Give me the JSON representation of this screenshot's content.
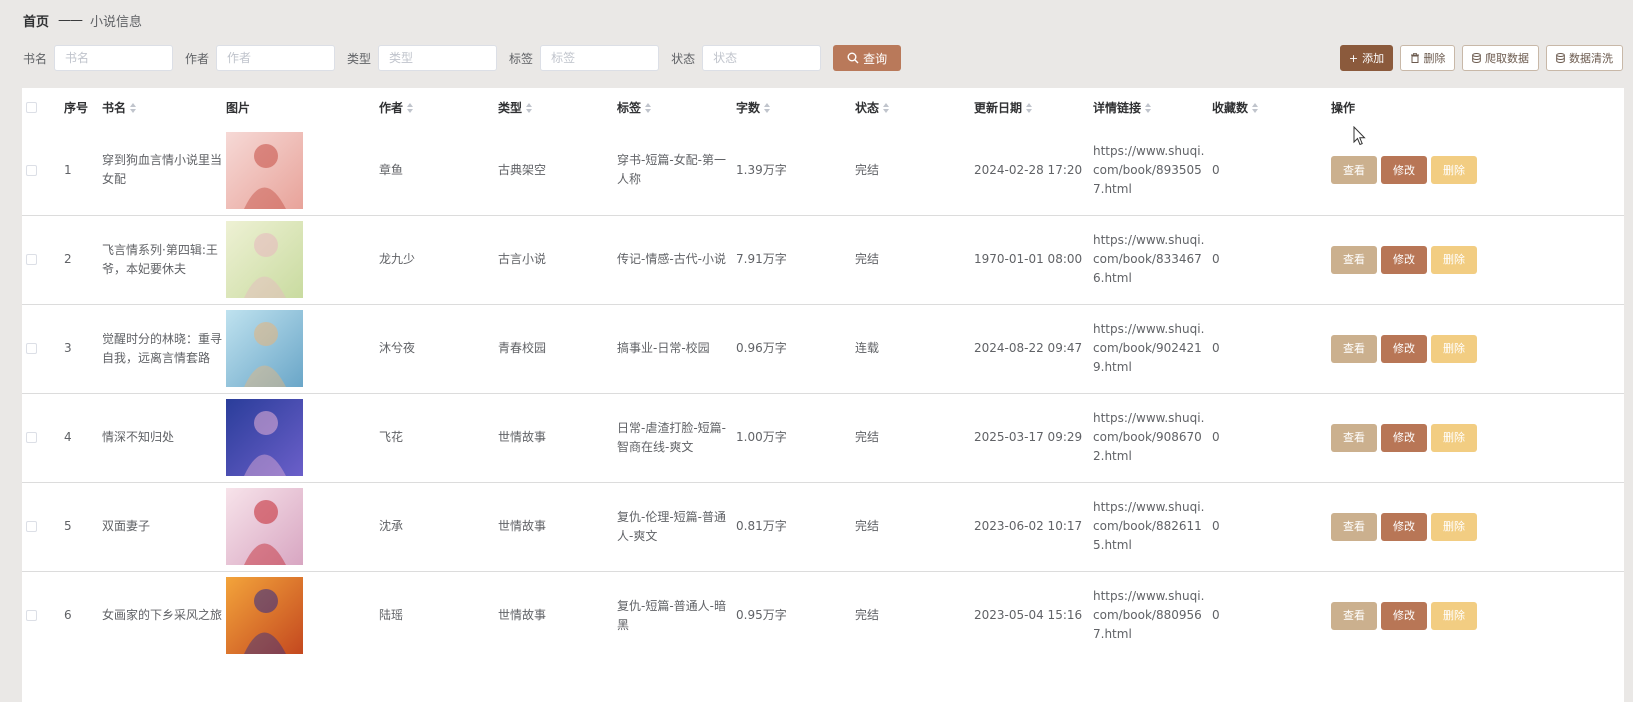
{
  "breadcrumb": {
    "home": "首页",
    "sep": "——",
    "current": "小说信息"
  },
  "search": {
    "fields": [
      {
        "label": "书名",
        "placeholder": "书名"
      },
      {
        "label": "作者",
        "placeholder": "作者"
      },
      {
        "label": "类型",
        "placeholder": "类型"
      },
      {
        "label": "标签",
        "placeholder": "标签"
      },
      {
        "label": "状态",
        "placeholder": "状态"
      }
    ],
    "query_label": "查询"
  },
  "toolbar": {
    "add": "添加",
    "delete": "删除",
    "crawl": "爬取数据",
    "clean": "数据清洗"
  },
  "table": {
    "columns": [
      "序号",
      "书名",
      "图片",
      "作者",
      "类型",
      "标签",
      "字数",
      "状态",
      "更新日期",
      "详情链接",
      "收藏数",
      "操作"
    ],
    "actions": {
      "view": "查看",
      "edit": "修改",
      "delete": "删除"
    },
    "rows": [
      {
        "idx": "1",
        "title": "穿到狗血言情小说里当女配",
        "author": "章鱼",
        "type": "古典架空",
        "tags": "穿书-短篇-女配-第一人称",
        "words": "1.39万字",
        "status": "完结",
        "date": "2024-02-28 17:20",
        "link": "https://www.shuqi.com/book/8935057.html",
        "fav": "0",
        "cover": [
          "#f6d9d6",
          "#e8a39a",
          "#c44d43"
        ]
      },
      {
        "idx": "2",
        "title": "飞言情系列·第四辑:王爷，本妃要休夫",
        "author": "龙九少",
        "type": "古言小说",
        "tags": "传记-情感-古代-小说",
        "words": "7.91万字",
        "status": "完结",
        "date": "1970-01-01 08:00",
        "link": "https://www.shuqi.com/book/8334676.html",
        "fav": "0",
        "cover": [
          "#eef1d4",
          "#c9dba0",
          "#e7b7c0"
        ]
      },
      {
        "idx": "3",
        "title": "觉醒时分的林晓：重寻自我，远离言情套路",
        "author": "沐兮夜",
        "type": "青春校园",
        "tags": "搞事业-日常-校园",
        "words": "0.96万字",
        "status": "连载",
        "date": "2024-08-22 09:47",
        "link": "https://www.shuqi.com/book/9024219.html",
        "fav": "0",
        "cover": [
          "#bfe2ef",
          "#6aa6c8",
          "#e8b57a"
        ]
      },
      {
        "idx": "4",
        "title": "情深不知归处",
        "author": "飞花",
        "type": "世情故事",
        "tags": "日常-虐渣打脸-短篇-智商在线-爽文",
        "words": "1.00万字",
        "status": "完结",
        "date": "2025-03-17 09:29",
        "link": "https://www.shuqi.com/book/9086702.html",
        "fav": "0",
        "cover": [
          "#2a3d9a",
          "#6b5fc9",
          "#e7b2d7"
        ]
      },
      {
        "idx": "5",
        "title": "双面妻子",
        "author": "沈承",
        "type": "世情故事",
        "tags": "复仇-伦理-短篇-普通人-爽文",
        "words": "0.81万字",
        "status": "完结",
        "date": "2023-06-02 10:17",
        "link": "https://www.shuqi.com/book/8826115.html",
        "fav": "0",
        "cover": [
          "#f7e3ea",
          "#d8a6c2",
          "#c2242d"
        ]
      },
      {
        "idx": "6",
        "title": "女画家的下乡采风之旅",
        "author": "陆瑶",
        "type": "世情故事",
        "tags": "复仇-短篇-普通人-暗黑",
        "words": "0.95万字",
        "status": "完结",
        "date": "2023-05-04 15:16",
        "link": "https://www.shuqi.com/book/8809567.html",
        "fav": "0",
        "cover": [
          "#f3a43b",
          "#c4481f",
          "#2d2a8a"
        ]
      }
    ]
  },
  "colors": {
    "query": "#b9795a",
    "add": "#8b5a3c",
    "view": "#cbb08e",
    "edit": "#b87656",
    "delete": "#f2cd82"
  }
}
